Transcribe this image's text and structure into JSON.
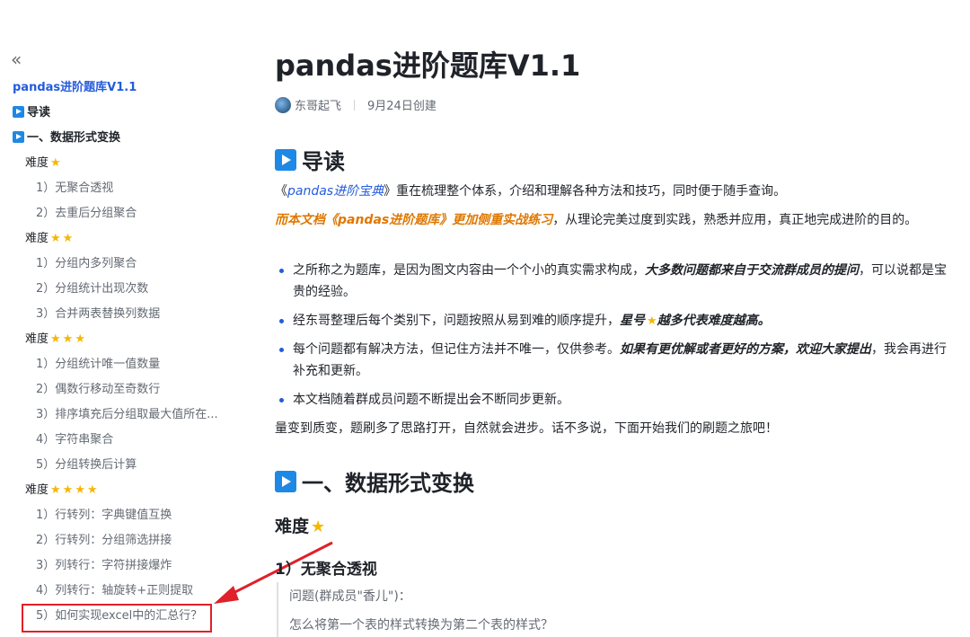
{
  "sidebar": {
    "collapse_label": "«",
    "title": "pandas进阶题库V1.1",
    "sections": {
      "intro": "导读",
      "section1": "一、数据形式变换"
    },
    "level1": "难度",
    "level1_items": [
      "1）无聚合透视",
      "2）去重后分组聚合"
    ],
    "level2": "难度",
    "level2_items": [
      "1）分组内多列聚合",
      "2）分组统计出现次数",
      "3）合并两表替换列数据"
    ],
    "level3": "难度",
    "level3_items": [
      "1）分组统计唯一值数量",
      "2）偶数行移动至奇数行",
      "3）排序填充后分组取最大值所在...",
      "4）字符串聚合",
      "5）分组转换后计算"
    ],
    "level4": "难度",
    "level4_items": [
      "1）行转列：字典键值互换",
      "2）行转列：分组筛选拼接",
      "3）列转行：字符拼接爆炸",
      "4）列转行：轴旋转+正则提取",
      "5）如何实现excel中的汇总行？"
    ]
  },
  "document": {
    "title": "pandas进阶题库V1.1",
    "author": "东哥起飞",
    "created": "9月24日创建",
    "h1_intro": "导读",
    "p1_prefix": "《",
    "p1_link": "pandas进阶宝典",
    "p1_suffix": "》重在梳理整个体系，介绍和理解各种方法和技巧，同时便于随手查询。",
    "p2_highlight": "而本文档《pandas进阶题库》更加侧重实战练习",
    "p2_rest": "，从理论完美过度到实践，熟悉并应用，真正地完成进阶的目的。",
    "b1_prefix": "之所称之为题库，是因为图文内容由一个个小的真实需求构成，",
    "b1_bold": "大多数问题都来自于交流群成员的提问",
    "b1_suffix": "，可以说都是宝贵的经验。",
    "b2_prefix": "经东哥整理后每个类别下，问题按照从易到难的顺序提升，",
    "b2_bold1": "星号",
    "b2_bold2": "越多代表难度越高。",
    "b3_prefix": "每个问题都有解决方法，但记住方法并不唯一，仅供参考。",
    "b3_bold": "如果有更优解或者更好的方案，欢迎大家提出",
    "b3_suffix": "，我会再进行补充和更新。",
    "b4": "本文档随着群成员问题不断提出会不断同步更新。",
    "p3": "量变到质变，题刷多了思路打开，自然就会进步。话不多说，下面开始我们的刷题之旅吧！",
    "h1_section1": "一、数据形式变换",
    "h2_level": "难度",
    "h3_q1": "1）无聚合透视",
    "quote_line1": "问题(群成员\"香儿\")：",
    "quote_line2": "怎么将第一个表的样式转换为第二个表的样式？"
  },
  "colors": {
    "accent_blue": "#245bdb",
    "icon_blue": "#1e88e5",
    "highlight_orange": "#de7802",
    "star": "#f5b700",
    "annotation_red": "#e0202a"
  },
  "icons": {
    "collapse": "double-chevron-left-icon",
    "play": "play-square-icon",
    "star": "star-icon",
    "avatar": "avatar"
  }
}
